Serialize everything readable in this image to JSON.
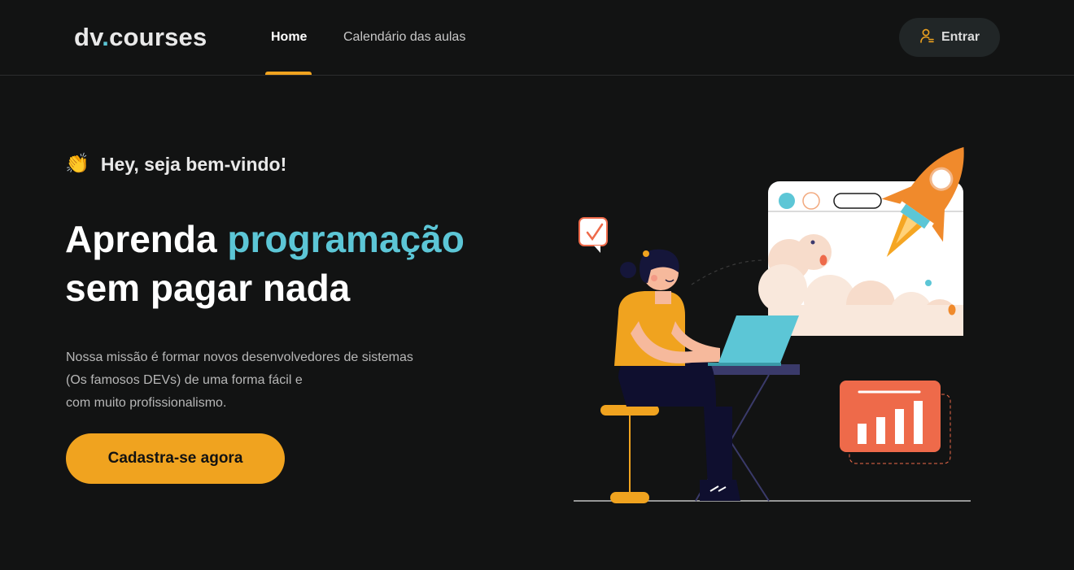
{
  "header": {
    "logo_prefix": "dv",
    "logo_dot": ".",
    "logo_suffix": "courses",
    "nav": [
      {
        "label": "Home",
        "active": true
      },
      {
        "label": "Calendário das aulas",
        "active": false
      }
    ],
    "login_label": "Entrar"
  },
  "hero": {
    "greeting_emoji": "👏",
    "greeting": "Hey, seja bem-vindo!",
    "headline_part1": "Aprenda ",
    "headline_accent": "programação",
    "headline_part2": "sem pagar nada",
    "description_lines": [
      "Nossa missão é formar novos desenvolvedores de sistemas",
      "(Os famosos DEVs) de uma forma fácil e",
      "com muito profissionalismo."
    ],
    "cta_label": "Cadastra-se agora"
  },
  "colors": {
    "background": "#121313",
    "accent_orange": "#f0a31f",
    "accent_cyan": "#5cc6d6"
  },
  "icons": {
    "login": "user-login-icon",
    "greeting": "clapping-hands-icon"
  }
}
